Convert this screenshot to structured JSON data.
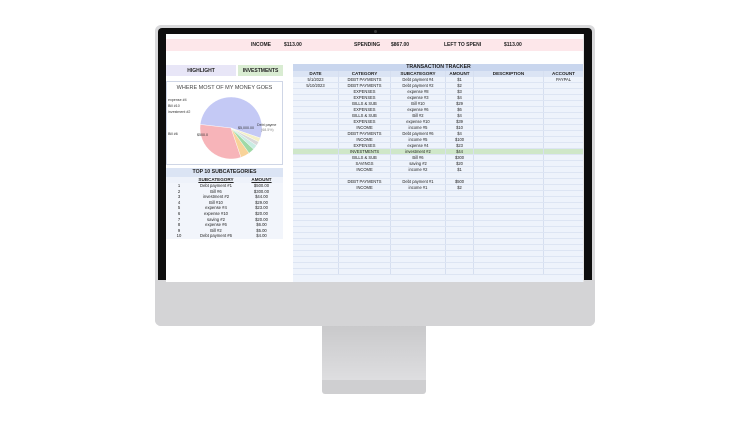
{
  "summary": {
    "income_label": "INCOME",
    "income_value": "$113.00",
    "spending_label": "SPENDING",
    "spending_value": "$867.00",
    "left_label": "LEFT TO SPENI",
    "left_value": "$113.00"
  },
  "nav": {
    "highlight": "HIGHLIGHT",
    "investments": "INVESTMENTS"
  },
  "pie": {
    "title": "WHERE MOST OF MY MONEY GOES",
    "labels": {
      "expense4": "expense #4",
      "bill10": "Bill #10",
      "investment2": "investment #2",
      "bill6": "Bill #6",
      "bill6_value": "$500.0",
      "debt1": "Debt payme",
      "debt1_value": "$5,000.00",
      "debt1_sub": "(68.5%)"
    },
    "colors": [
      "#c4c9f5",
      "#f7b4b9",
      "#f8d39a",
      "#9fd9a6",
      "#c9ece3",
      "#d9d9d9",
      "#f4f0c8"
    ]
  },
  "top10": {
    "title": "TOP 10 SUBCATEGORIES",
    "headers": {
      "sub": "SUBCATEGORY",
      "amt": "AMOUNT"
    },
    "rows": [
      {
        "rank": "1",
        "sub": "Debt payment #1",
        "amt": "$500.00"
      },
      {
        "rank": "2",
        "sub": "Bill #6",
        "amt": "$300.00"
      },
      {
        "rank": "3",
        "sub": "investment #2",
        "amt": "$44.00"
      },
      {
        "rank": "4",
        "sub": "Bill #10",
        "amt": "$29.00"
      },
      {
        "rank": "5",
        "sub": "expense #4",
        "amt": "$23.00"
      },
      {
        "rank": "6",
        "sub": "expense #10",
        "amt": "$20.00"
      },
      {
        "rank": "7",
        "sub": "saving #2",
        "amt": "$20.00"
      },
      {
        "rank": "8",
        "sub": "expense #6",
        "amt": "$6.00"
      },
      {
        "rank": "9",
        "sub": "Bill #2",
        "amt": "$5.00"
      },
      {
        "rank": "10",
        "sub": "Debt payment #6",
        "amt": "$4.00"
      }
    ]
  },
  "tracker": {
    "title": "TRANSACTION TRACKER",
    "headers": {
      "date": "DATE",
      "category": "CATEGORY",
      "subcategory": "SUBCATEGORY",
      "amount": "AMOUNT",
      "description": "DESCRIPTION",
      "account": "ACCOUNT"
    },
    "rows": [
      {
        "date": "5/1/2023",
        "category": "DEBT PAYMENTS",
        "subcategory": "Debt payment #4",
        "amount": "$1",
        "description": "",
        "account": "PAYPAL"
      },
      {
        "date": "5/10/2023",
        "category": "DEBT PAYMENTS",
        "subcategory": "Debt payment #2",
        "amount": "$2",
        "description": "",
        "account": ""
      },
      {
        "date": "",
        "category": "EXPENSES",
        "subcategory": "expense #8",
        "amount": "$3",
        "description": "",
        "account": ""
      },
      {
        "date": "",
        "category": "EXPENSES",
        "subcategory": "expense #3",
        "amount": "$4",
        "description": "",
        "account": ""
      },
      {
        "date": "",
        "category": "BILLS & SUB",
        "subcategory": "Bill #10",
        "amount": "$29",
        "description": "",
        "account": ""
      },
      {
        "date": "",
        "category": "EXPENSES",
        "subcategory": "expense #6",
        "amount": "$6",
        "description": "",
        "account": ""
      },
      {
        "date": "",
        "category": "BILLS & SUB",
        "subcategory": "Bill #2",
        "amount": "$4",
        "description": "",
        "account": ""
      },
      {
        "date": "",
        "category": "EXPENSES",
        "subcategory": "expense #10",
        "amount": "$39",
        "description": "",
        "account": ""
      },
      {
        "date": "",
        "category": "INCOME",
        "subcategory": "income #5",
        "amount": "$10",
        "description": "",
        "account": ""
      },
      {
        "date": "",
        "category": "DEBT PAYMENTS",
        "subcategory": "Debt payment #6",
        "amount": "$4",
        "description": "",
        "account": ""
      },
      {
        "date": "",
        "category": "INCOME",
        "subcategory": "income #5",
        "amount": "$100",
        "description": "",
        "account": ""
      },
      {
        "date": "",
        "category": "EXPENSES",
        "subcategory": "expense #4",
        "amount": "$23",
        "description": "",
        "account": ""
      },
      {
        "date": "",
        "category": "INVESTMENTS",
        "subcategory": "investment #2",
        "amount": "$44",
        "description": "",
        "account": ""
      },
      {
        "date": "",
        "category": "BILLS & SUB",
        "subcategory": "Bill #6",
        "amount": "$300",
        "description": "",
        "account": ""
      },
      {
        "date": "",
        "category": "SAVINGS",
        "subcategory": "saving #2",
        "amount": "$20",
        "description": "",
        "account": ""
      },
      {
        "date": "",
        "category": "INCOME",
        "subcategory": "income #2",
        "amount": "$1",
        "description": "",
        "account": ""
      },
      {
        "date": "",
        "category": "",
        "subcategory": "",
        "amount": "",
        "description": "",
        "account": ""
      },
      {
        "date": "",
        "category": "DEBT PAYMENTS",
        "subcategory": "Debt payment #1",
        "amount": "$500",
        "description": "",
        "account": ""
      },
      {
        "date": "",
        "category": "INCOME",
        "subcategory": "income #1",
        "amount": "$2",
        "description": "",
        "account": ""
      }
    ],
    "highlight_category": "INVESTMENTS",
    "empty_rows": 14
  }
}
